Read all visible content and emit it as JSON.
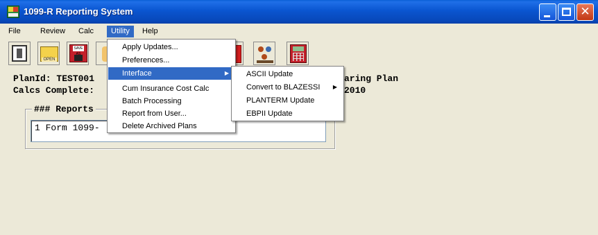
{
  "window": {
    "title": "1099-R Reporting System",
    "app_icon": "1099r-app-icon",
    "controls": {
      "minimize_icon": "minimize-icon",
      "maximize_icon": "maximize-icon",
      "close_icon": "close-icon",
      "close_glyph": "✕"
    }
  },
  "menubar": {
    "file": "File",
    "review": "Review",
    "calc": "Calc",
    "utility": "Utility",
    "help": "Help"
  },
  "toolbar": {
    "exit_icon": "exit-door-icon",
    "open_icon": "open-folder-icon",
    "open_label": "OPEN",
    "save_icon": "save-disk-icon",
    "save_label": "SAVE AS",
    "hand_icon": "hand-icon",
    "red_icon": "red-book-icon",
    "people_icon": "people-icon",
    "calc_icon": "calculator-icon"
  },
  "main": {
    "plan_id_line": "PlanId: TEST001",
    "calcs_complete_line": "Calcs Complete:",
    "plan_name_tail": "aring Plan",
    "date_tail": "2010",
    "reports_label": "### Reports",
    "reports": [
      "1 Form 1099-"
    ]
  },
  "utility_menu": {
    "items": [
      "Apply Updates...",
      "Preferences...",
      "Interface",
      "Cum Insurance Cost Calc",
      "Batch Processing",
      "Report from User...",
      "Delete Archived Plans"
    ],
    "highlighted": "Interface",
    "submenu_arrow": "▶"
  },
  "interface_submenu": {
    "items": [
      "ASCII Update",
      "Convert to BLAZESSI",
      "PLANTERM Update",
      "EBPII Update"
    ],
    "submenu_arrow": "▶"
  },
  "colors": {
    "titlebar": "#0a55d0",
    "highlight": "#316ac5",
    "face": "#ece9d8",
    "close_button": "#c13714"
  }
}
